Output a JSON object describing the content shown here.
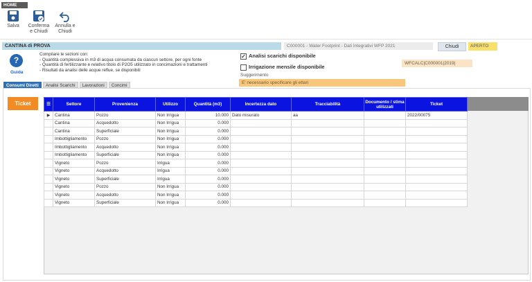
{
  "ribbon": {
    "tab": "HOME",
    "buttons": [
      {
        "label": "Salva"
      },
      {
        "label": "Conferma e Chiudi"
      },
      {
        "label": "Annulla e Chiudi"
      }
    ]
  },
  "header": {
    "title": "CANTINA di PROVA",
    "doc_ref": "C000001 - Water Footprint - Dati Integrativi WFP 2021",
    "close_label": "Chiudi",
    "status": "APERTO"
  },
  "help": {
    "icon_char": "?",
    "label": "Guida",
    "lines": [
      "Compilare le sezioni con:",
      "- Quantità complessiva in m3 di acqua consumata da ciascun settore, per ogni fonte",
      "- Quantità di fertilizzante e relativo titolo di P2O5 utilizzato in concimazioni e trattamenti",
      "- Risultati da analisi delle acque reflue, se disponibili"
    ]
  },
  "options": {
    "analisi_label": "Analisi scarichi disponibile",
    "analisi_checked": true,
    "irrigazione_label": "Irrigazione mensile disponibile",
    "irrigazione_checked": false
  },
  "suggestion": {
    "label": "Suggerimento",
    "text": "E' necessario specificare gli ettari"
  },
  "wfcalc": "WFCALC|C000001|2019|",
  "tabs": [
    "Consumi Diretti",
    "Analisi Scarichi",
    "Lavorazioni",
    "Concimi"
  ],
  "ticket_label": "Ticket",
  "grid": {
    "columns": [
      "Settore",
      "Provenienza",
      "Utilizzo",
      "Quantità (m3)",
      "Incertezza dato",
      "Tracciabilità",
      "Documento / stima utilizzati",
      "Ticket"
    ],
    "rows": [
      [
        "Cantina",
        "Pozzo",
        "Non Irrigua",
        "10.000",
        "Dato misurato",
        "aa",
        "",
        "2022/00075"
      ],
      [
        "Cantina",
        "Acquedotto",
        "Non Irrigua",
        "0.000",
        "",
        "",
        "",
        ""
      ],
      [
        "Cantina",
        "Superficiale",
        "Non Irrigua",
        "0.000",
        "",
        "",
        "",
        ""
      ],
      [
        "Imbottigliamento",
        "Pozzo",
        "Non Irrigua",
        "0.000",
        "",
        "",
        "",
        ""
      ],
      [
        "Imbottigliamento",
        "Acquedotto",
        "Non Irrigua",
        "0.000",
        "",
        "",
        "",
        ""
      ],
      [
        "Imbottigliamento",
        "Superficiale",
        "Non Irrigua",
        "0.000",
        "",
        "",
        "",
        ""
      ],
      [
        "Vigneto",
        "Pozzo",
        "Irrigua",
        "0.000",
        "",
        "",
        "",
        ""
      ],
      [
        "Vigneto",
        "Acquedotto",
        "Irrigua",
        "0.000",
        "",
        "",
        "",
        ""
      ],
      [
        "Vigneto",
        "Superficiale",
        "Irrigua",
        "0.000",
        "",
        "",
        "",
        ""
      ],
      [
        "Vigneto",
        "Pozzo",
        "Non Irrigua",
        "0.000",
        "",
        "",
        "",
        ""
      ],
      [
        "Vigneto",
        "Acquedotto",
        "Non Irrigua",
        "0.000",
        "",
        "",
        "",
        ""
      ],
      [
        "Vigneto",
        "Superficiale",
        "Non Irrigua",
        "0.000",
        "",
        "",
        "",
        ""
      ]
    ]
  },
  "colors": {
    "grid_header": "#0a13e0",
    "ticket_button": "#f28b24",
    "title_bar": "#b9dbe7",
    "status": "#f9e06a",
    "active_tab": "#2f6fb5"
  }
}
